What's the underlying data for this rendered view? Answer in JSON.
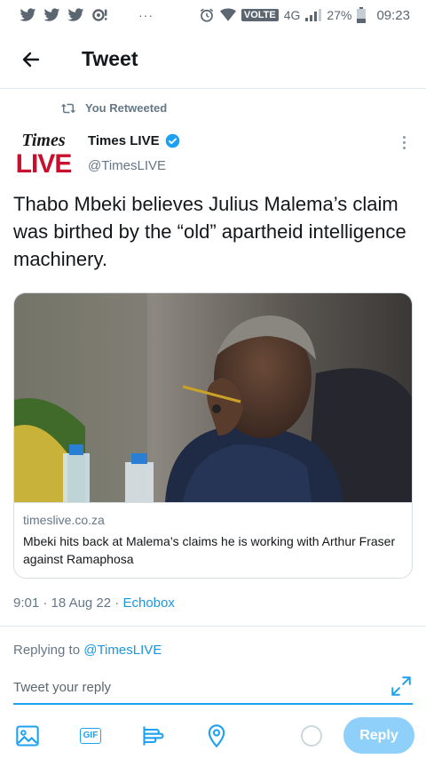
{
  "status_bar": {
    "volte": "VOLTE",
    "network": "4G",
    "battery": "27%",
    "time": "09:23",
    "dots": "···"
  },
  "header": {
    "title": "Tweet"
  },
  "tweet": {
    "retweet_context": "You Retweeted",
    "avatar": {
      "line1": "Times",
      "line2": "LIVE"
    },
    "author_name": "Times LIVE",
    "author_handle": "@TimesLIVE",
    "text": "Thabo Mbeki believes Julius Malema’s claim was birthed by the “old” apartheid intelligence machinery.",
    "card": {
      "domain": "timeslive.co.za",
      "title": "Mbeki hits back at Malema’s claims he is working with Arthur Fraser against Ramaphosa"
    },
    "meta": {
      "time": "9:01",
      "sep1": " · ",
      "date": "18 Aug 22",
      "sep2": " · ",
      "source": "Echobox"
    }
  },
  "reply": {
    "replying_label": "Replying to ",
    "replying_handle": "@TimesLIVE",
    "placeholder": "Tweet your reply",
    "button_label": "Reply"
  },
  "toolbar": {
    "gif_label": "GIF"
  },
  "colors": {
    "accent": "#1da1f2",
    "link": "#1b95e0",
    "secondary_text": "#657786",
    "brand_red": "#c8102e",
    "reply_button_disabled": "#8ed0f9"
  }
}
